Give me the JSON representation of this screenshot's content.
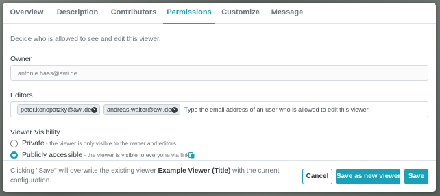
{
  "tabs": [
    {
      "label": "Overview",
      "active": false
    },
    {
      "label": "Description",
      "active": false
    },
    {
      "label": "Contributors",
      "active": false
    },
    {
      "label": "Permissions",
      "active": true
    },
    {
      "label": "Customize",
      "active": false
    },
    {
      "label": "Message",
      "active": false
    }
  ],
  "intro": "Decide who is allowed to see and edit this viewer.",
  "owner": {
    "label": "Owner",
    "value": "antonie.haas@awi.de"
  },
  "editors": {
    "label": "Editors",
    "chips": [
      "peter.konopatzky@awi.de",
      "andreas.walter@awi.de"
    ],
    "placeholder": "Type the email address of an user who is allowed to edit this viewer"
  },
  "visibility": {
    "label": "Viewer Visibility",
    "options": [
      {
        "title": "Private",
        "desc": " - the viewer is only visible to the owner and editors",
        "checked": false
      },
      {
        "title": "Publicly accessible",
        "desc": " - the viewer is visible to everyone via link",
        "checked": true
      }
    ]
  },
  "footer": {
    "msg_pre": "Clicking \"Save\" will overwrite the existing viewer ",
    "msg_name": "Example Viewer (Title)",
    "msg_post": " with the current configuration.",
    "cancel": "Cancel",
    "save_new": "Save as new viewer",
    "save": "Save"
  },
  "colors": {
    "accent": "#17a2b8",
    "text": "#343a40",
    "muted": "#6c757d"
  },
  "icons": {
    "chip_remove": "close-circle-icon",
    "copy_link": "copy-icon"
  }
}
